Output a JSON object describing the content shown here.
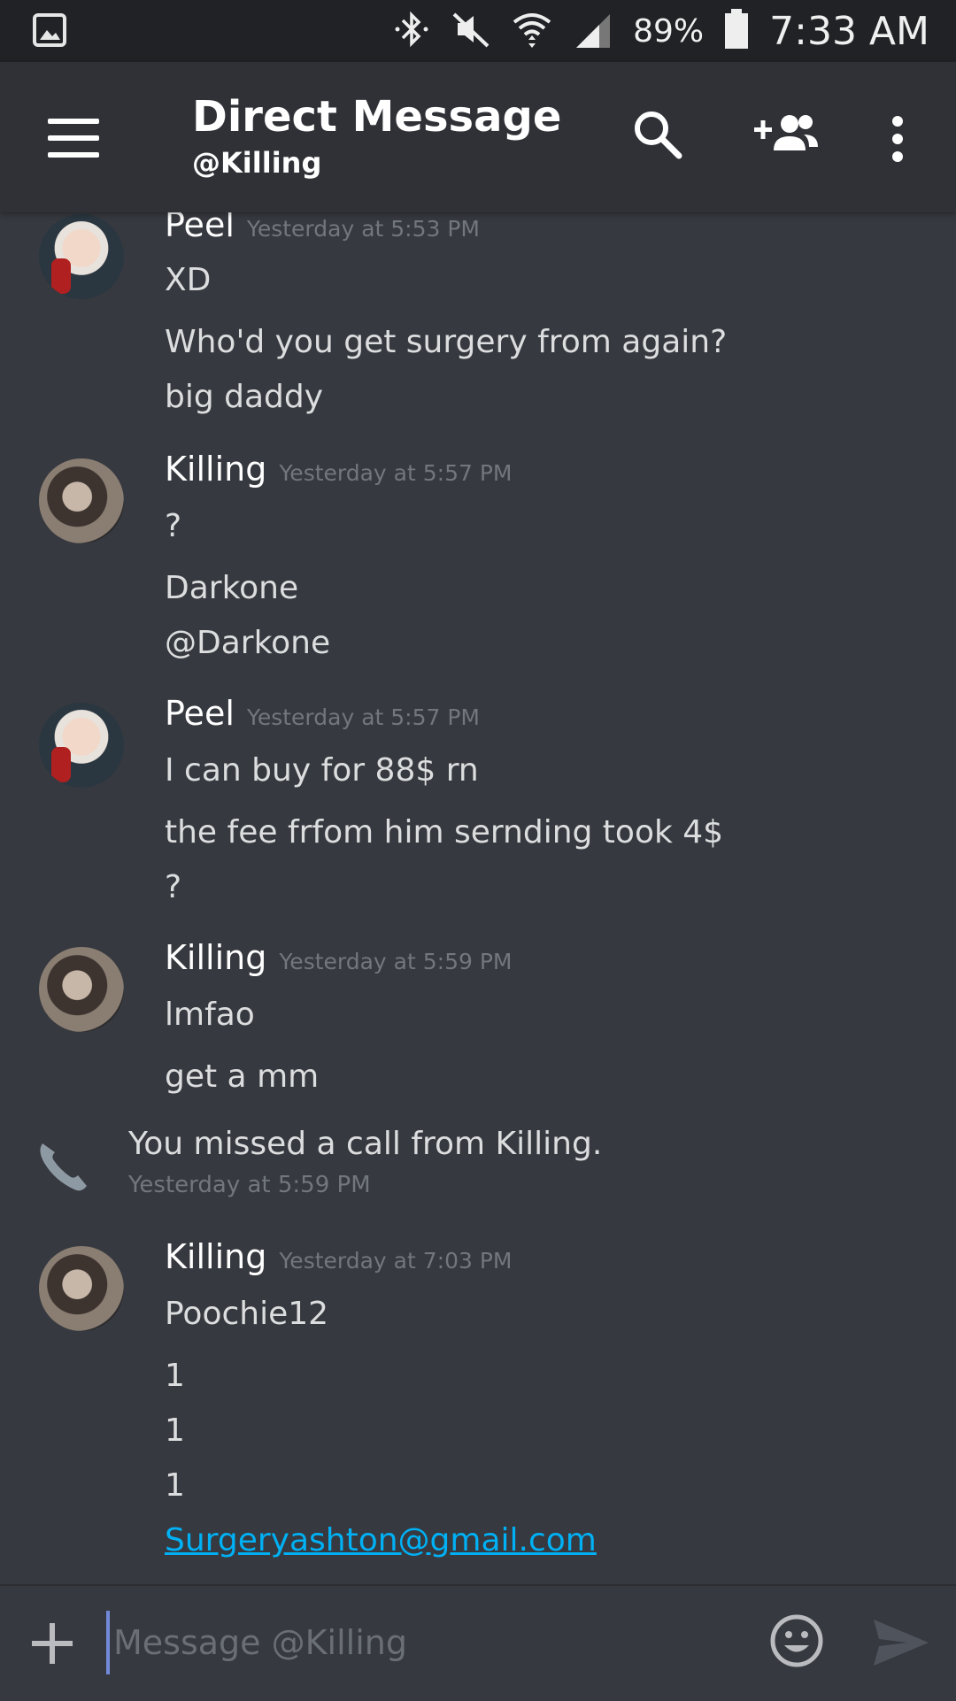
{
  "status_bar": {
    "battery": "89%",
    "time": "7:33 AM"
  },
  "header": {
    "title": "Direct Message",
    "subtitle": "@Killing"
  },
  "messages": [
    {
      "author": "Peel",
      "timestamp": "Yesterday at 5:53 PM",
      "lines": [
        "XD",
        "Who'd you get surgery from again?",
        "big daddy"
      ]
    },
    {
      "author": "Killing",
      "timestamp": "Yesterday at 5:57 PM",
      "lines": [
        "?",
        "Darkone",
        "@Darkone"
      ]
    },
    {
      "author": "Peel",
      "timestamp": "Yesterday at 5:57 PM",
      "lines": [
        "I can buy for 88$ rn",
        "the fee frfom him sernding took 4$",
        "?"
      ]
    },
    {
      "author": "Killing",
      "timestamp": "Yesterday at 5:59 PM",
      "lines": [
        "lmfao",
        "get a mm"
      ]
    },
    {
      "author": "Killing",
      "timestamp": "Yesterday at 7:03 PM",
      "lines": [
        "Poochie12",
        "1",
        "1",
        "1"
      ],
      "link": "Surgeryashton@gmail.com"
    }
  ],
  "missed_call": {
    "text": "You missed a call from Killing.",
    "timestamp": "Yesterday at 5:59 PM"
  },
  "composer": {
    "placeholder": "Message @Killing"
  },
  "colors": {
    "background": "#36393f",
    "header": "#2f3136",
    "status_bar": "#202225",
    "link": "#00b0f4",
    "timestamp": "#72767d",
    "cursor": "#7289da"
  }
}
